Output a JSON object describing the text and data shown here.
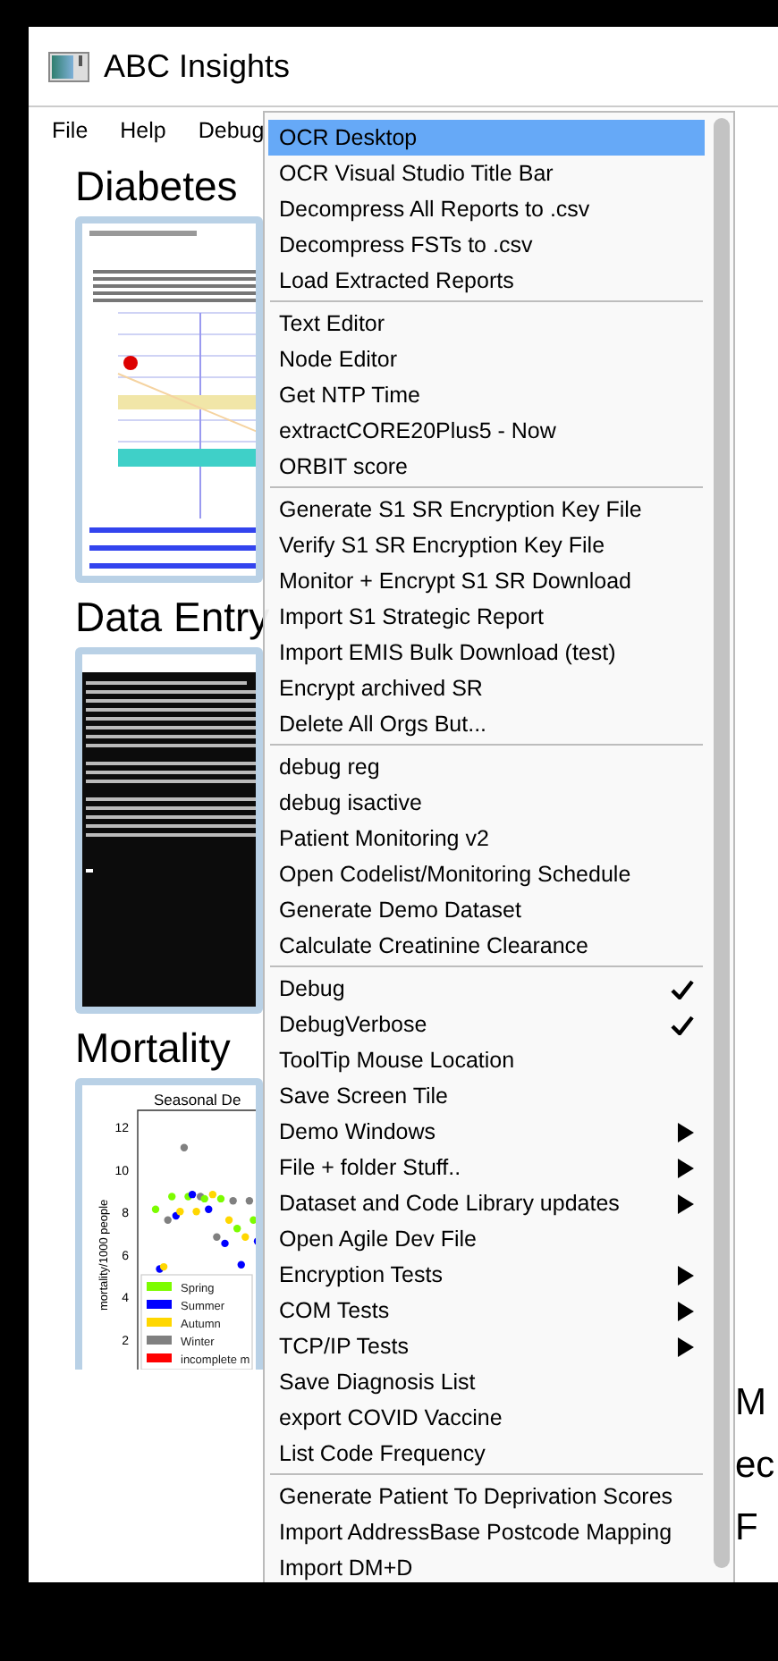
{
  "window": {
    "title": "ABC Insights"
  },
  "menubar": [
    {
      "label": "File"
    },
    {
      "label": "Help"
    },
    {
      "label": "Debug"
    }
  ],
  "sections": [
    {
      "heading": "Diabetes",
      "kind": "report"
    },
    {
      "heading": "Data Entry",
      "kind": "console"
    },
    {
      "heading": "Mortality",
      "kind": "chart",
      "chart_image": {
        "title": "Seasonal De",
        "ylabel": "mortality/1000 people",
        "y_tick_labels": [
          "12",
          "10",
          "8",
          "6",
          "4",
          "2"
        ],
        "legend": [
          {
            "label": "Spring",
            "color": "#7cfc00"
          },
          {
            "label": "Summer",
            "color": "#0000ff"
          },
          {
            "label": "Autumn",
            "color": "#ffd700"
          },
          {
            "label": "Winter",
            "color": "#808080"
          },
          {
            "label": "incomplete m",
            "color": "#ff0000"
          }
        ]
      }
    }
  ],
  "notice": [
    "M",
    "ec",
    "F"
  ],
  "menu": {
    "groups": [
      {
        "items": [
          {
            "label": "OCR Desktop",
            "selected": true,
            "checked": false,
            "submenu": false
          },
          {
            "label": "OCR Visual Studio Title Bar",
            "selected": false,
            "checked": false,
            "submenu": false
          },
          {
            "label": "Decompress All Reports to .csv",
            "selected": false,
            "checked": false,
            "submenu": false
          },
          {
            "label": "Decompress FSTs to .csv",
            "selected": false,
            "checked": false,
            "submenu": false
          },
          {
            "label": "Load Extracted Reports",
            "selected": false,
            "checked": false,
            "submenu": false
          }
        ]
      },
      {
        "items": [
          {
            "label": "Text Editor",
            "selected": false,
            "checked": false,
            "submenu": false
          },
          {
            "label": "Node Editor",
            "selected": false,
            "checked": false,
            "submenu": false
          },
          {
            "label": "Get NTP Time",
            "selected": false,
            "checked": false,
            "submenu": false
          },
          {
            "label": "extractCORE20Plus5 - Now",
            "selected": false,
            "checked": false,
            "submenu": false
          },
          {
            "label": "ORBIT score",
            "selected": false,
            "checked": false,
            "submenu": false
          }
        ]
      },
      {
        "items": [
          {
            "label": "Generate S1 SR Encryption Key File",
            "selected": false,
            "checked": false,
            "submenu": false
          },
          {
            "label": "Verify S1 SR Encryption Key File",
            "selected": false,
            "checked": false,
            "submenu": false
          },
          {
            "label": "Monitor + Encrypt S1 SR Download",
            "selected": false,
            "checked": false,
            "submenu": false
          },
          {
            "label": "Import S1 Strategic Report",
            "selected": false,
            "checked": false,
            "submenu": false
          },
          {
            "label": "Import EMIS Bulk Download (test)",
            "selected": false,
            "checked": false,
            "submenu": false
          },
          {
            "label": "Encrypt archived SR",
            "selected": false,
            "checked": false,
            "submenu": false
          },
          {
            "label": "Delete All Orgs But...",
            "selected": false,
            "checked": false,
            "submenu": false
          }
        ]
      },
      {
        "items": [
          {
            "label": "debug reg",
            "selected": false,
            "checked": false,
            "submenu": false
          },
          {
            "label": "debug isactive",
            "selected": false,
            "checked": false,
            "submenu": false
          },
          {
            "label": "Patient Monitoring v2",
            "selected": false,
            "checked": false,
            "submenu": false
          },
          {
            "label": "Open Codelist/Monitoring Schedule",
            "selected": false,
            "checked": false,
            "submenu": false
          },
          {
            "label": "Generate Demo Dataset",
            "selected": false,
            "checked": false,
            "submenu": false
          },
          {
            "label": "Calculate Creatinine Clearance",
            "selected": false,
            "checked": false,
            "submenu": false
          }
        ]
      },
      {
        "items": [
          {
            "label": "Debug",
            "selected": false,
            "checked": true,
            "submenu": false
          },
          {
            "label": "DebugVerbose",
            "selected": false,
            "checked": true,
            "submenu": false
          },
          {
            "label": "ToolTip Mouse Location",
            "selected": false,
            "checked": false,
            "submenu": false
          },
          {
            "label": "Save Screen Tile",
            "selected": false,
            "checked": false,
            "submenu": false
          },
          {
            "label": "Demo Windows",
            "selected": false,
            "checked": false,
            "submenu": true
          },
          {
            "label": "File + folder Stuff..",
            "selected": false,
            "checked": false,
            "submenu": true
          },
          {
            "label": "Dataset and Code Library updates",
            "selected": false,
            "checked": false,
            "submenu": true
          },
          {
            "label": "Open Agile Dev File",
            "selected": false,
            "checked": false,
            "submenu": false
          },
          {
            "label": "Encryption Tests",
            "selected": false,
            "checked": false,
            "submenu": true
          },
          {
            "label": "COM Tests",
            "selected": false,
            "checked": false,
            "submenu": true
          },
          {
            "label": "TCP/IP Tests",
            "selected": false,
            "checked": false,
            "submenu": true
          },
          {
            "label": "Save Diagnosis List",
            "selected": false,
            "checked": false,
            "submenu": false
          },
          {
            "label": "export COVID Vaccine",
            "selected": false,
            "checked": false,
            "submenu": false
          },
          {
            "label": "List Code Frequency",
            "selected": false,
            "checked": false,
            "submenu": false
          }
        ]
      },
      {
        "items": [
          {
            "label": "Generate Patient To Deprivation Scores",
            "selected": false,
            "checked": false,
            "submenu": false
          },
          {
            "label": "Import AddressBase Postcode Mapping",
            "selected": false,
            "checked": false,
            "submenu": false
          },
          {
            "label": "Import DM+D",
            "selected": false,
            "checked": false,
            "submenu": false
          }
        ]
      }
    ]
  }
}
